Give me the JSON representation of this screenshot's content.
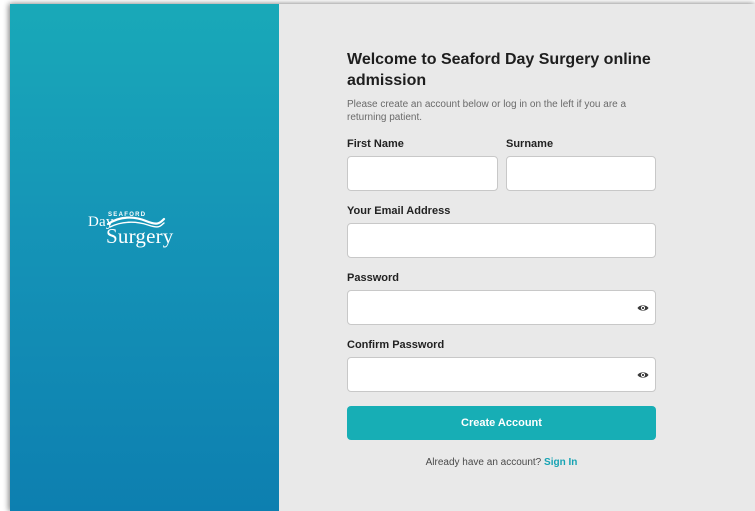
{
  "brand": {
    "logo_small": "SEAFORD",
    "logo_day": "Day",
    "logo_main": "Surgery"
  },
  "form": {
    "title": "Welcome to Seaford Day Surgery online admission",
    "subtitle": "Please create an account below or log in on the left if you are a returning patient.",
    "first_name_label": "First Name",
    "surname_label": "Surname",
    "email_label": "Your Email Address",
    "password_label": "Password",
    "confirm_password_label": "Confirm Password",
    "first_name_value": "",
    "surname_value": "",
    "email_value": "",
    "password_value": "",
    "confirm_password_value": "",
    "create_button": "Create Account",
    "already_text": "Already have an account?",
    "sign_in_link": "Sign In"
  },
  "colors": {
    "panel_gradient_top": "#19a9b8",
    "panel_gradient_bottom": "#0d7fb0",
    "accent": "#17aeb5",
    "link": "#17a3b3",
    "form_background": "#e9e9e9"
  },
  "icons": {
    "password_toggle": "eye-icon",
    "confirm_password_toggle": "eye-icon"
  }
}
